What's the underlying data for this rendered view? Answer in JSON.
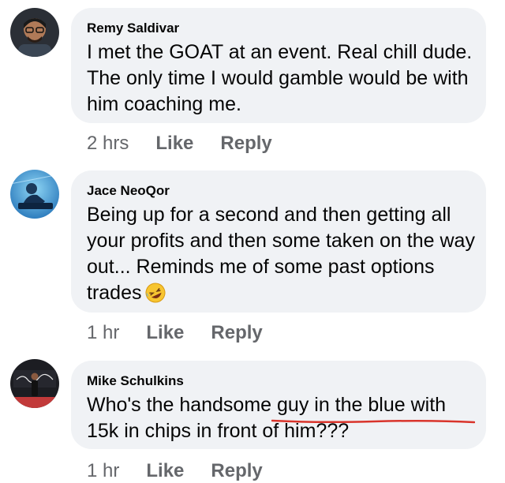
{
  "comments": [
    {
      "author": "Remy Saldivar",
      "text": "I met the GOAT at an event. Real chill dude. The only time I would gamble would be with him coaching me.",
      "time": "2 hrs",
      "like_label": "Like",
      "reply_label": "Reply",
      "avatar_icon": "avatar-man-glasses"
    },
    {
      "author": "Jace NeoQor",
      "text": "Being up for a second and then getting all your profits and then some taken on the way out... Reminds me of some past options trades",
      "emoji": "rolling-on-floor-laughing-emoji",
      "time": "1 hr",
      "like_label": "Like",
      "reply_label": "Reply",
      "avatar_icon": "avatar-blue-dj"
    },
    {
      "author": "Mike Schulkins",
      "text": "Who's the handsome guy in the blue with 15k in chips in front of him???",
      "highlight_color": "#d9342b",
      "time": "1 hr",
      "like_label": "Like",
      "reply_label": "Reply",
      "avatar_icon": "avatar-person-banner"
    }
  ],
  "colors": {
    "bubble": "#f0f2f5",
    "text": "#050505",
    "meta": "#65676b"
  }
}
